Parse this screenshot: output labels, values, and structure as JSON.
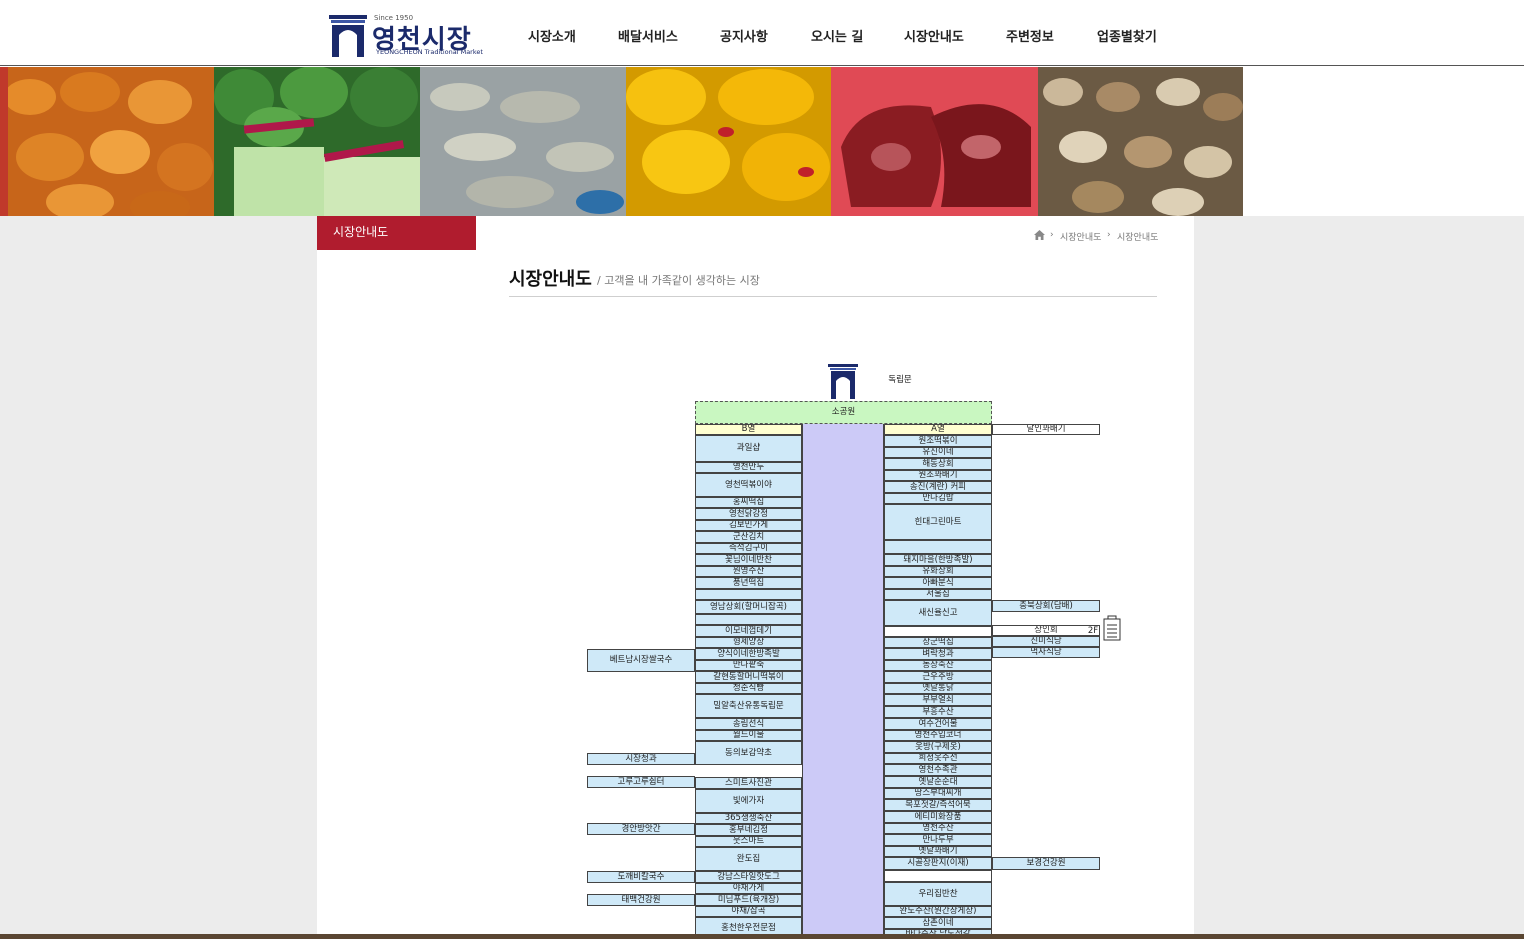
{
  "logo": {
    "since": "Since 1950",
    "title": "영천시장",
    "subtitle": "YEONGCHEON Traditional Market"
  },
  "nav": [
    "시장소개",
    "배달서비스",
    "공지사항",
    "오시는 길",
    "시장안내도",
    "주변정보",
    "업종별찾기"
  ],
  "sidebar": {
    "tab": "시장안내도"
  },
  "breadcrumb": [
    "시장안내도",
    "시장안내도"
  ],
  "page": {
    "title": "시장안내도",
    "subtitle": "/ 고객을 내 가족같이 생각하는 시장"
  },
  "map": {
    "gate_label": "독립문",
    "park": "소공원",
    "col_b_header": "B열",
    "col_a_header": "A열",
    "right_header": "달인꽈배기",
    "floor_label": "2F",
    "col_b": [
      "과일샵",
      "영천만두",
      "영천떡볶이야",
      "홍씨떡집",
      "영천닭강정",
      "김보민가게",
      "군산김치",
      "즉석김구이",
      "꽃님이네반찬",
      "원영수산",
      "풍년떡집",
      "",
      "영남상회(할머니잡곡)",
      "",
      "이모네껍데기",
      "형제양장",
      "양식이네한방족발",
      "만나팥죽",
      "갈현동할머니떡볶이",
      "청춘식빵",
      "밀알축산유통독립문",
      "송림선식",
      "월드이불",
      "동의보감약초",
      "스미트사진관",
      "빛에가자",
      "365생생축산",
      "홍부네김정",
      "웃스마트",
      "완도집",
      "강남스타일핫도그",
      "야채가게",
      "미님푸드(육개장)",
      "야채/잡곡",
      "홍천한우전문점"
    ],
    "col_a": [
      "원조떡볶이",
      "유진이네",
      "해동상회",
      "원조꽈배기",
      "송진(계란) 커피",
      "만나김밥",
      "힌대그린마트",
      "",
      "돼지마을(한방족발)",
      "유화상회",
      "아빠분식",
      "서울집",
      "새신율신고",
      "",
      "장군떡집",
      "벼락청과",
      "농장축산",
      "근우주방",
      "옛날통닭",
      "부부열쇠",
      "부흥수산",
      "여수건어물",
      "영천수입코너",
      "옷방(구제옷)",
      "희정옷수선",
      "영천수족관",
      "옛날순순대",
      "땅스부대찌개",
      "목포젓갈/즉석어묵",
      "에티미화장품",
      "영천수산",
      "만나두부",
      "옛날꽈배기",
      "시골장판지(이재)",
      "",
      "우리집반찬",
      "완도수산(원간장게장)",
      "삼촌이네",
      "바다수산 남도젓갈"
    ],
    "right_col": [
      "충북상회(담배)",
      "상인회",
      "진미식당",
      "먹자식당",
      "보경건강원"
    ],
    "left_col": [
      "베트남시장쌀국수",
      "시장청과",
      "고루고루쉼터",
      "경안방앗간",
      "도깨비칼국수",
      "태백건강원"
    ]
  }
}
